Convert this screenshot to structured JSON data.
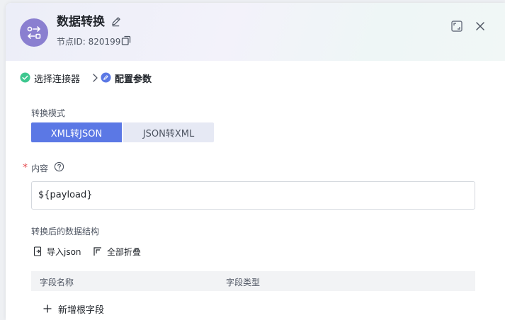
{
  "header": {
    "title": "数据转换",
    "node_id_label": "节点ID: 820199",
    "icon": "data-transform-icon",
    "icon_bg": "#8a7fd0"
  },
  "steps": [
    {
      "label": "选择连接器",
      "status": "done"
    },
    {
      "label": "配置参数",
      "status": "active"
    }
  ],
  "form": {
    "mode": {
      "label": "转换模式",
      "options": [
        "XML转JSON",
        "JSON转XML"
      ],
      "selected": "XML转JSON"
    },
    "content": {
      "required_mark": "*",
      "label": "内容",
      "value": "${payload}"
    },
    "structure": {
      "label": "转换后的数据结构",
      "import_label": "导入json",
      "collapse_label": "全部折叠",
      "columns": [
        "字段名称",
        "字段类型"
      ],
      "add_root_label": "新增根字段"
    }
  },
  "colors": {
    "primary": "#5b78e5",
    "success": "#3ec78f",
    "required": "#e5484d"
  }
}
